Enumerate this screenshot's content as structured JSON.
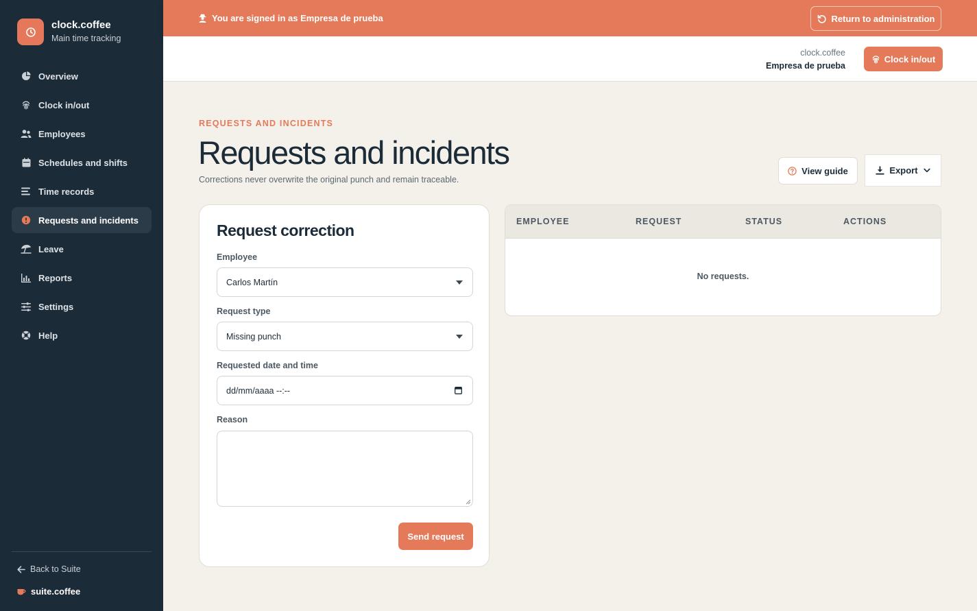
{
  "brand": {
    "name": "clock.coffee",
    "subtitle": "Main time tracking"
  },
  "sidebar": {
    "items": [
      {
        "label": "Overview",
        "icon": "pie-chart-icon",
        "active": false
      },
      {
        "label": "Clock in/out",
        "icon": "fingerprint-icon",
        "active": false
      },
      {
        "label": "Employees",
        "icon": "users-icon",
        "active": false
      },
      {
        "label": "Schedules and shifts",
        "icon": "calendar-icon",
        "active": false
      },
      {
        "label": "Time records",
        "icon": "list-icon",
        "active": false
      },
      {
        "label": "Requests and incidents",
        "icon": "alert-circle-icon",
        "active": true
      },
      {
        "label": "Leave",
        "icon": "umbrella-beach-icon",
        "active": false
      },
      {
        "label": "Reports",
        "icon": "bar-chart-icon",
        "active": false
      },
      {
        "label": "Settings",
        "icon": "sliders-icon",
        "active": false
      },
      {
        "label": "Help",
        "icon": "lifebuoy-icon",
        "active": false
      }
    ],
    "back_label": "Back to Suite",
    "suite_brand": "suite.coffee"
  },
  "banner": {
    "signed_in_text": "You are signed in as Empresa de prueba",
    "return_label": "Return to administration"
  },
  "header": {
    "app_name": "clock.coffee",
    "org_name": "Empresa de prueba",
    "clock_label": "Clock in/out"
  },
  "page": {
    "eyebrow": "REQUESTS AND INCIDENTS",
    "title": "Requests and incidents",
    "subtitle": "Corrections never overwrite the original punch and remain traceable.",
    "guide_label": "View guide",
    "export_label": "Export"
  },
  "form": {
    "title": "Request correction",
    "employee_label": "Employee",
    "employee_value": "Carlos Martín",
    "type_label": "Request type",
    "type_value": "Missing punch",
    "datetime_label": "Requested date and time",
    "datetime_placeholder": "dd/mm/aaaa --:--",
    "reason_label": "Reason",
    "reason_value": "",
    "submit_label": "Send request"
  },
  "table": {
    "columns": [
      "EMPLOYEE",
      "REQUEST",
      "STATUS",
      "ACTIONS"
    ],
    "empty_text": "No requests."
  },
  "colors": {
    "accent": "#e57a5b",
    "sidebar_bg": "#1c2b38",
    "page_bg": "#f4f1eb",
    "text_dark": "#1b2b38"
  }
}
